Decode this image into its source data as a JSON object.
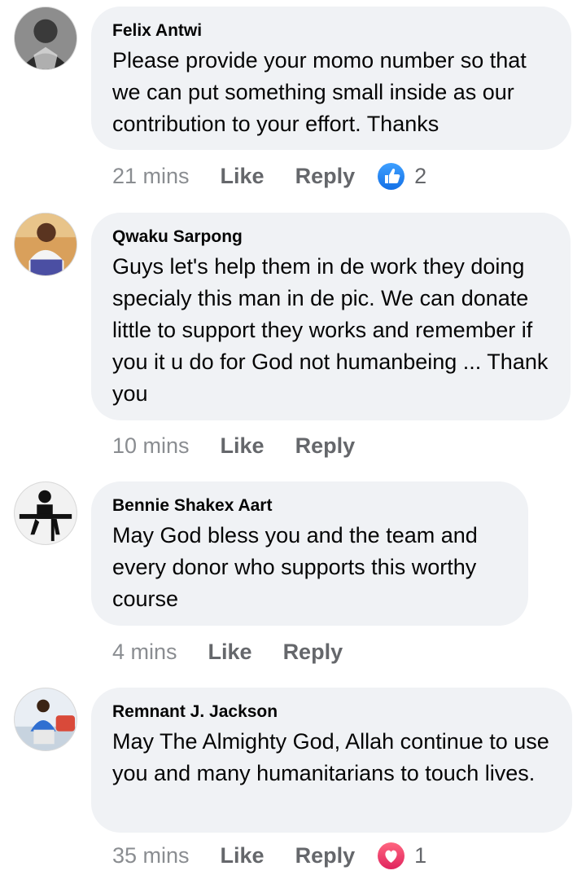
{
  "comments": [
    {
      "author": "Felix Antwi",
      "text": "Please provide your momo number so that we can put something small inside as our contribution to your effort. Thanks",
      "time": "21 mins",
      "like_label": "Like",
      "reply_label": "Reply",
      "reaction_icon": "like-icon",
      "reaction_count": "2"
    },
    {
      "author": "Qwaku Sarpong",
      "text": "Guys let's help them in de work they doing specialy this man in de pic. We can donate little to support they works and remember if you it u do for God not humanbeing ... Thank you",
      "time": "10 mins",
      "like_label": "Like",
      "reply_label": "Reply"
    },
    {
      "author": "Bennie Shakex Aart",
      "text": "May God bless you and the team and every donor who supports this worthy course",
      "time": "4 mins",
      "like_label": "Like",
      "reply_label": "Reply"
    },
    {
      "author": "Remnant J. Jackson",
      "text": "May The Almighty God, Allah continue to use you and many humanitarians to touch lives.",
      "time": "35 mins",
      "like_label": "Like",
      "reply_label": "Reply",
      "reaction_icon": "love-icon",
      "reaction_count": "1"
    }
  ],
  "colors": {
    "bubble": "#f0f2f5",
    "meta_text": "#65676b",
    "like_blue": "#1877f2",
    "love_red": "#e0245e"
  }
}
